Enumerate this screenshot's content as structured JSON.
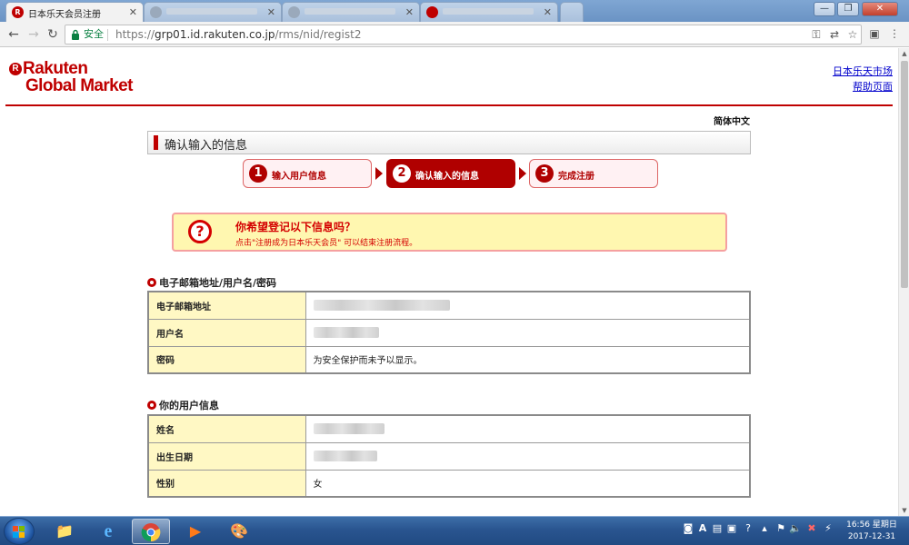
{
  "browser": {
    "active_tab_title": "日本乐天会员注册",
    "secure_label": "安全",
    "url_scheme": "https://",
    "url_host": "grp01.id.rakuten.co.jp",
    "url_path": "/rms/nid/regist2"
  },
  "header": {
    "logo_line1": "Rakuten",
    "logo_line2": "Global Market",
    "link_market": "日本乐天市场",
    "link_help": "帮助页面"
  },
  "language": "简体中文",
  "page_title": "确认输入的信息",
  "steps": [
    {
      "num": "1",
      "label": "输入用户信息",
      "active": false
    },
    {
      "num": "2",
      "label": "确认输入的信息",
      "active": true
    },
    {
      "num": "3",
      "label": "完成注册",
      "active": false
    }
  ],
  "confirm": {
    "heading": "你希望登记以下信息吗？",
    "subtext": "点击\"注册成为日本乐天会员\" 可以结束注册流程。"
  },
  "section_account": {
    "title": "电子邮箱地址/用户名/密码",
    "rows": [
      {
        "label": "电子邮箱地址"
      },
      {
        "label": "用户名"
      },
      {
        "label": "密码",
        "value": "为安全保护而未予以显示。"
      }
    ]
  },
  "section_user": {
    "title": "你的用户信息",
    "rows": [
      {
        "label": "姓名"
      },
      {
        "label": "出生日期"
      },
      {
        "label": "性别",
        "value": "女"
      }
    ]
  },
  "taskbar": {
    "time": "16:56 星期日",
    "date": "2017-12-31"
  }
}
